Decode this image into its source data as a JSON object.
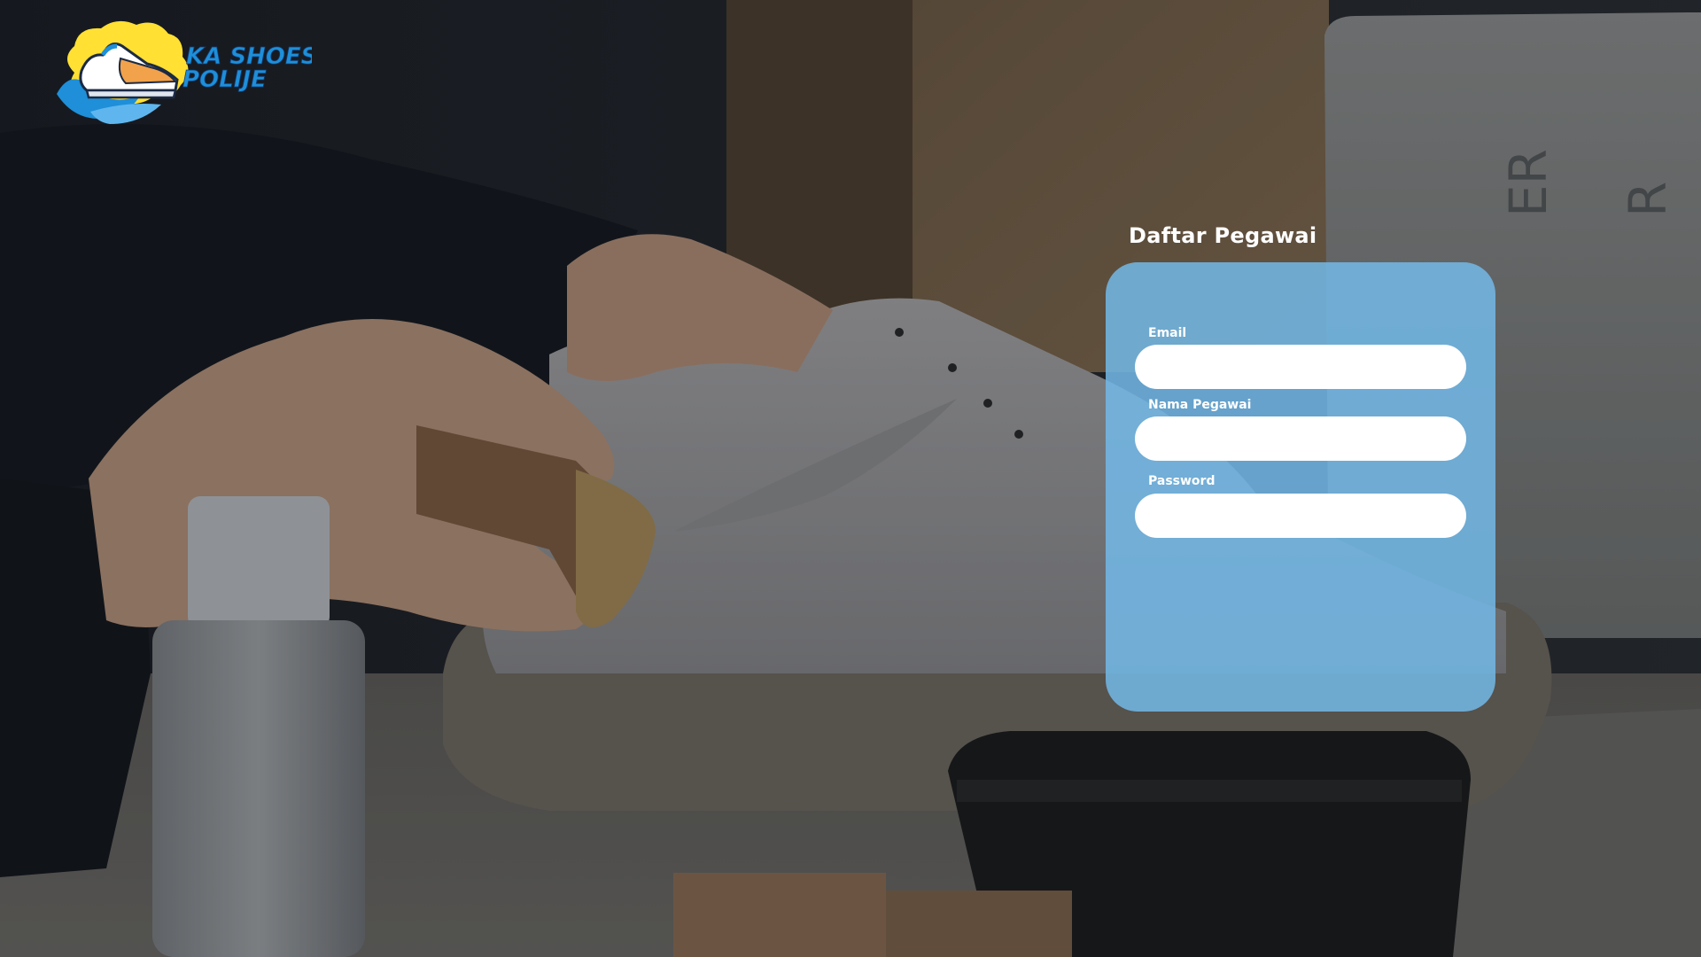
{
  "brand": {
    "logo_text_line1": "KA SHOES",
    "logo_text_line2": "POLIJE",
    "colors": {
      "yellow": "#FFE033",
      "blue": "#1E8FD8",
      "orange": "#F2A24A"
    },
    "icon": "sneaker-logo-icon"
  },
  "form": {
    "title": "Daftar Pegawai",
    "panel_color": "#72B8E6",
    "fields": [
      {
        "label": "Email",
        "value": "",
        "placeholder": ""
      },
      {
        "label": "Nama Pegawai",
        "value": "",
        "placeholder": ""
      },
      {
        "label": "Password",
        "value": "",
        "placeholder": ""
      }
    ]
  }
}
